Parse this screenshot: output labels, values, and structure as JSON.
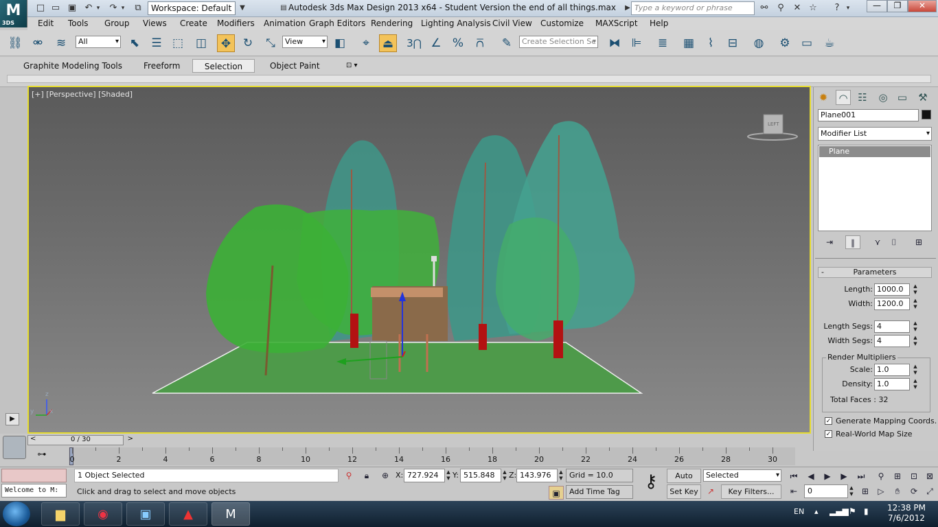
{
  "titlebar": {
    "logo": "3DS",
    "workspace": "Workspace: Default",
    "title": "Autodesk 3ds Max Design 2013 x64  -  Student Version     the end of all things.max",
    "search_placeholder": "Type a keyword or phrase"
  },
  "menus": [
    "Edit",
    "Tools",
    "Group",
    "Views",
    "Create",
    "Modifiers",
    "Animation",
    "Graph Editors",
    "Rendering",
    "Lighting Analysis",
    "Civil View",
    "Customize",
    "MAXScript",
    "Help"
  ],
  "toolbar": {
    "filter": "All",
    "ref_coord": "View",
    "snap_label": "3",
    "named_selection_placeholder": "Create Selection Se"
  },
  "ribbon": {
    "tabs": [
      "Graphite Modeling Tools",
      "Freeform",
      "Selection",
      "Object Paint"
    ],
    "active": "Selection"
  },
  "viewport": {
    "label": "[+] [Perspective] [Shaded]",
    "viewcube_face": "LEFT",
    "axis": {
      "x": "x",
      "y": "y",
      "z": "z"
    }
  },
  "command_panel": {
    "object_name": "Plane001",
    "modifier_list": "Modifier List",
    "stack": [
      "Plane"
    ],
    "rollout_title": "Parameters",
    "length_label": "Length:",
    "length": "1000.0",
    "width_label": "Width:",
    "width": "1200.0",
    "length_segs_label": "Length Segs:",
    "length_segs": "4",
    "width_segs_label": "Width Segs:",
    "width_segs": "4",
    "render_mult_title": "Render Multipliers",
    "scale_label": "Scale:",
    "scale": "1.0",
    "density_label": "Density:",
    "density": "1.0",
    "total_faces": "Total Faces : 32",
    "gen_mapping": "Generate Mapping Coords.",
    "real_world": "Real-World Map Size",
    "gen_mapping_checked": true,
    "real_world_checked": true
  },
  "timeline": {
    "frame_counter": "0 / 30",
    "ticks": [
      0,
      2,
      4,
      6,
      8,
      10,
      12,
      14,
      16,
      18,
      20,
      22,
      24,
      26,
      28,
      30
    ]
  },
  "status": {
    "maxscript": "Welcome to M:",
    "selected": "1 Object Selected",
    "prompt": "Click and drag to select and move objects",
    "x_label": "X:",
    "x": "727.924",
    "y_label": "Y:",
    "y": "515.848",
    "z_label": "Z:",
    "z": "143.976",
    "grid": "Grid = 10.0",
    "add_time_tag": "Add Time Tag",
    "auto_key": "Auto Key",
    "set_key": "Set Key",
    "selected_dd": "Selected",
    "key_filters": "Key Filters...",
    "current_frame": "0"
  },
  "taskbar": {
    "lang": "EN",
    "time": "12:38 PM",
    "date": "7/6/2012"
  },
  "colors": {
    "viewport_border": "#e6dc2e",
    "active_tool": "#f3c35a"
  }
}
